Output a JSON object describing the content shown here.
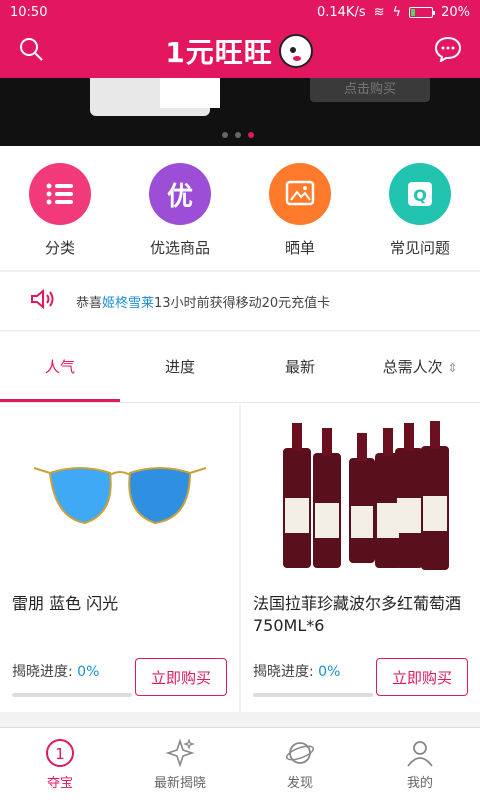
{
  "status_bar": {
    "time": "10:50",
    "network": "0.14K/s",
    "battery": "20%",
    "battery_level": 0.2
  },
  "header": {
    "title": "1元旺旺"
  },
  "banner": {
    "button_text": "点击购买",
    "dots": 3,
    "active_dot": 2
  },
  "categories": [
    {
      "label": "分类",
      "icon": "list-icon",
      "color": "#f2397a"
    },
    {
      "label": "优选商品",
      "icon": "you-icon",
      "glyph": "优",
      "color": "#9c4fd6"
    },
    {
      "label": "晒单",
      "icon": "image-icon",
      "color": "#ff7a2b"
    },
    {
      "label": "常见问题",
      "icon": "qa-icon",
      "color": "#22c4b0"
    }
  ],
  "notice": {
    "prefix": "恭喜",
    "user": "姬柊雪莱",
    "message": "13小时前获得移动20元充值卡"
  },
  "tabs": [
    {
      "label": "人气",
      "active": true
    },
    {
      "label": "进度",
      "active": false
    },
    {
      "label": "最新",
      "active": false
    },
    {
      "label": "总需人次",
      "active": false
    }
  ],
  "products": [
    {
      "name": "雷朋 蓝色 闪光",
      "progress_label": "揭晓进度:",
      "progress": "0%",
      "buy_label": "立即购买"
    },
    {
      "name": "法国拉菲珍藏波尔多红葡萄酒750ML*6",
      "progress_label": "揭晓进度:",
      "progress": "0%",
      "buy_label": "立即购买"
    }
  ],
  "bottom_nav": [
    {
      "label": "夺宝",
      "icon": "circle-one-icon",
      "glyph": "1",
      "active": true
    },
    {
      "label": "最新揭晓",
      "icon": "sparkle-icon",
      "active": false
    },
    {
      "label": "发现",
      "icon": "planet-icon",
      "active": false
    },
    {
      "label": "我的",
      "icon": "person-icon",
      "active": false
    }
  ]
}
